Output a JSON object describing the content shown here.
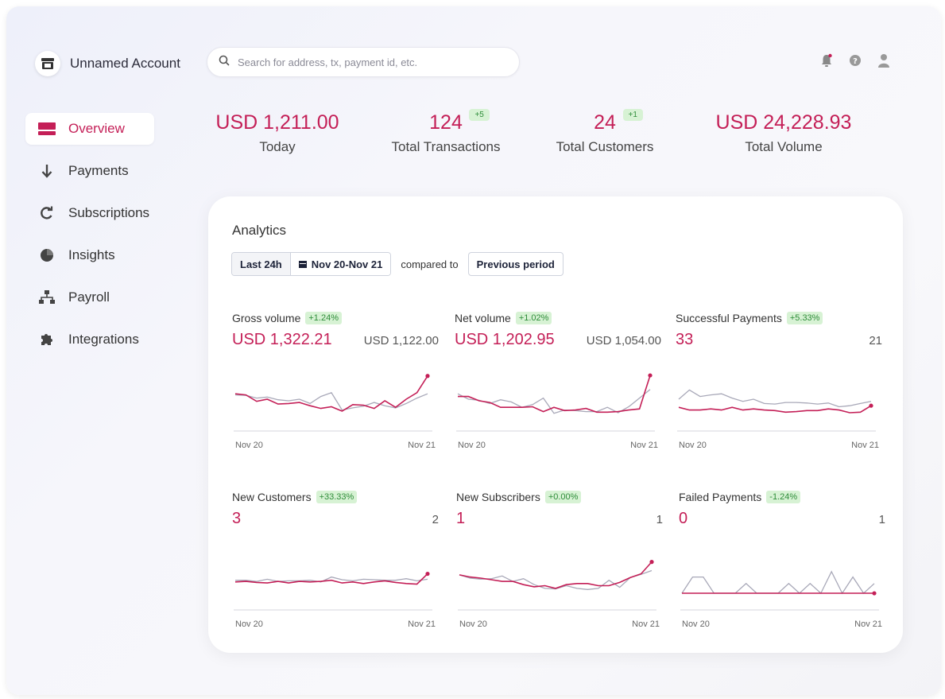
{
  "account": {
    "name": "Unnamed Account",
    "icon": "store-icon"
  },
  "search": {
    "placeholder": "Search for address, tx, payment id, etc."
  },
  "header_icons": [
    "bell-icon",
    "help-icon",
    "user-icon"
  ],
  "sidebar": {
    "items": [
      {
        "label": "Overview",
        "icon": "overview-icon",
        "active": true
      },
      {
        "label": "Payments",
        "icon": "arrow-down-icon",
        "active": false
      },
      {
        "label": "Subscriptions",
        "icon": "refresh-icon",
        "active": false
      },
      {
        "label": "Insights",
        "icon": "pie-chart-icon",
        "active": false
      },
      {
        "label": "Payroll",
        "icon": "org-chart-icon",
        "active": false
      },
      {
        "label": "Integrations",
        "icon": "puzzle-icon",
        "active": false
      }
    ]
  },
  "stats": [
    {
      "value": "USD 1,211.00",
      "label": "Today",
      "delta": ""
    },
    {
      "value": "124",
      "label": "Total Transactions",
      "delta": "+5"
    },
    {
      "value": "24",
      "label": "Total Customers",
      "delta": "+1"
    },
    {
      "value": "USD 24,228.93",
      "label": "Total Volume",
      "delta": ""
    }
  ],
  "analytics": {
    "title": "Analytics",
    "range_button": "Last 24h",
    "date_range": "Nov 20-Nov 21",
    "compared_label": "compared to",
    "compare_button": "Previous period",
    "axis_start": "Nov 20",
    "axis_end": "Nov 21"
  },
  "colors": {
    "accent": "#c41f57",
    "previous": "#a8a8b8",
    "badge_bg": "#d7f2d4",
    "badge_text": "#2f8d3a"
  },
  "chart_data": [
    {
      "type": "line",
      "title": "Gross volume",
      "change": "+1.24%",
      "current": "USD 1,322.21",
      "previous": "USD 1,122.00",
      "x_labels": [
        "Nov 20",
        "Nov 21"
      ],
      "series": [
        {
          "values": [
            60,
            58,
            46,
            50,
            41,
            42,
            44,
            38,
            33,
            36,
            28,
            40,
            39,
            33,
            47,
            35,
            50,
            62,
            93
          ]
        },
        {
          "values": [
            58,
            57,
            52,
            54,
            49,
            47,
            50,
            42,
            55,
            62,
            30,
            34,
            37,
            44,
            38,
            34,
            42,
            52,
            60
          ]
        }
      ]
    },
    {
      "type": "line",
      "title": "Net volume",
      "change": "+1.02%",
      "current": "USD 1,202.95",
      "previous": "USD 1,054.00",
      "x_labels": [
        "Nov 20",
        "Nov 21"
      ],
      "series": [
        {
          "values": [
            55,
            55,
            47,
            44,
            35,
            35,
            35,
            36,
            27,
            35,
            29,
            30,
            33,
            26,
            26,
            27,
            30,
            32,
            94
          ]
        },
        {
          "values": [
            60,
            50,
            48,
            42,
            49,
            45,
            35,
            40,
            52,
            24,
            30,
            29,
            27,
            27,
            35,
            25,
            36,
            52,
            68
          ]
        }
      ]
    },
    {
      "type": "line",
      "title": "Successful Payments",
      "change": "+5.33%",
      "current": "33",
      "previous": "21",
      "x_labels": [
        "Nov 20",
        "Nov 21"
      ],
      "series": [
        {
          "values": [
            35,
            30,
            30,
            32,
            30,
            35,
            30,
            32,
            30,
            29,
            26,
            27,
            29,
            29,
            32,
            30,
            25,
            26,
            38
          ]
        },
        {
          "values": [
            50,
            67,
            55,
            58,
            60,
            52,
            46,
            50,
            42,
            41,
            44,
            44,
            43,
            41,
            43,
            36,
            38,
            42,
            46
          ]
        }
      ]
    },
    {
      "type": "line",
      "title": "New Customers",
      "change": "+33.33%",
      "current": "3",
      "previous": "2",
      "x_labels": [
        "Nov 20",
        "Nov 21"
      ],
      "series": [
        {
          "values": [
            43,
            44,
            42,
            41,
            44,
            41,
            44,
            43,
            44,
            46,
            41,
            43,
            40,
            43,
            45,
            42,
            40,
            39,
            58
          ]
        },
        {
          "values": [
            46,
            46,
            44,
            48,
            44,
            45,
            45,
            46,
            43,
            52,
            47,
            45,
            48,
            47,
            46,
            46,
            49,
            45,
            48
          ]
        }
      ]
    },
    {
      "type": "line",
      "title": "New Subscribers",
      "change": "+0.00%",
      "current": "1",
      "previous": "1",
      "x_labels": [
        "Nov 20",
        "Nov 21"
      ],
      "series": [
        {
          "values": [
            56,
            52,
            50,
            47,
            44,
            44,
            38,
            34,
            36,
            31,
            38,
            40,
            40,
            36,
            36,
            42,
            51,
            58,
            80
          ]
        },
        {
          "values": [
            56,
            50,
            48,
            49,
            54,
            44,
            49,
            38,
            31,
            30,
            36,
            31,
            29,
            31,
            46,
            33,
            51,
            57,
            64
          ]
        }
      ]
    },
    {
      "type": "line",
      "title": "Failed Payments",
      "change": "-1.24%",
      "current": "0",
      "previous": "1",
      "x_labels": [
        "Nov 20",
        "Nov 21"
      ],
      "series": [
        {
          "values": [
            22,
            22,
            22,
            22,
            22,
            22,
            22,
            22,
            22,
            22,
            22,
            22,
            22,
            22,
            22,
            22,
            22,
            22,
            22
          ]
        },
        {
          "values": [
            22,
            52,
            52,
            22,
            22,
            22,
            40,
            22,
            22,
            22,
            40,
            22,
            40,
            22,
            62,
            22,
            52,
            22,
            40
          ]
        }
      ]
    }
  ]
}
